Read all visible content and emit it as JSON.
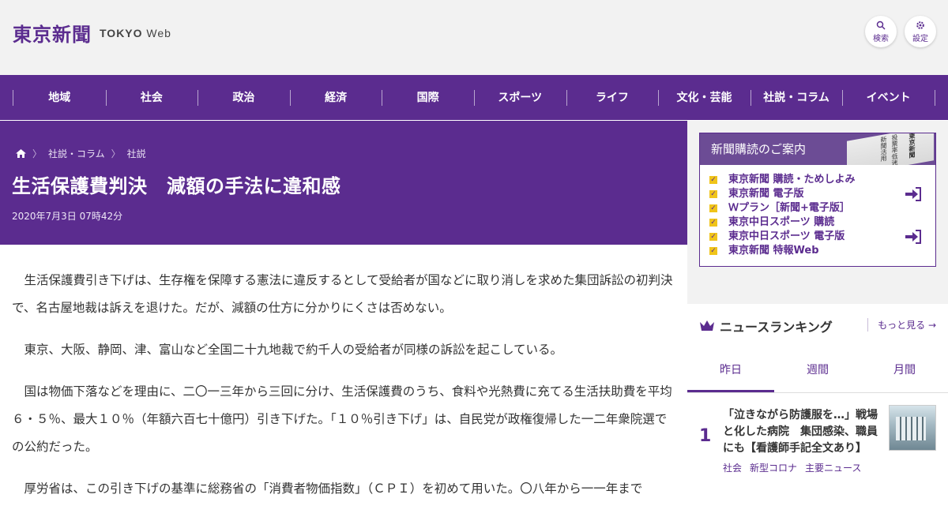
{
  "header": {
    "logo_kanji": "東京新聞",
    "logo_tokyo": "TOKYO",
    "logo_web": "Web",
    "search_label": "検索",
    "settings_label": "設定"
  },
  "nav": [
    "地域",
    "社会",
    "政治",
    "経済",
    "国際",
    "スポーツ",
    "ライフ",
    "文化・芸能",
    "社説・コラム",
    "イベント"
  ],
  "breadcrumb": [
    "社説・コラム",
    "社説"
  ],
  "article": {
    "title": "生活保護費判決　減額の手法に違和感",
    "date": "2020年7月3日 07時42分",
    "paragraphs": [
      "生活保護費引き下げは、生存権を保障する憲法に違反するとして受給者が国などに取り消しを求めた集団訴訟の初判決で、名古屋地裁は訴えを退けた。だが、減額の仕方に分かりにくさは否めない。",
      "東京、大阪、静岡、津、富山など全国二十九地裁で約千人の受給者が同様の訴訟を起こしている。",
      "国は物価下落などを理由に、二〇一三年から三回に分け、生活保護費のうち、食料や光熱費に充てる生活扶助費を平均６・５％、最大１０％（年額六百七十億円）引き下げた。「１０％引き下げ」は、自民党が政権復帰した一二年衆院選での公約だった。",
      "厚労省は、この引き下げの基準に総務省の「消費者物価指数」（ＣＰＩ）を初めて用いた。〇八年から一一年まで"
    ]
  },
  "subscription": {
    "heading": "新聞購読のご案内",
    "newspaper_text": [
      "東京新聞",
      "投票率低迷",
      "新聞活用"
    ],
    "items": [
      "東京新聞 購読・ためしよみ",
      "東京新聞 電子版",
      "Ｗプラン［新聞+電子版］",
      "東京中日スポーツ 購読",
      "東京中日スポーツ 電子版",
      "東京新聞 特報Web"
    ]
  },
  "ranking": {
    "heading": "ニュースランキング",
    "more": "もっと見る",
    "tabs": [
      "昨日",
      "週間",
      "月間"
    ],
    "items": [
      {
        "rank": "1",
        "title": "「泣きながら防護服を…」戦場と化した病院　集団感染、職員にも【看護師手記全文あり】",
        "tags": [
          "社会",
          "新型コロナ",
          "主要ニュース"
        ]
      }
    ]
  },
  "colors": {
    "brand": "#5b2c8f",
    "header_bg": "#f2f2f2",
    "accent_yellow": "#f0c419"
  }
}
